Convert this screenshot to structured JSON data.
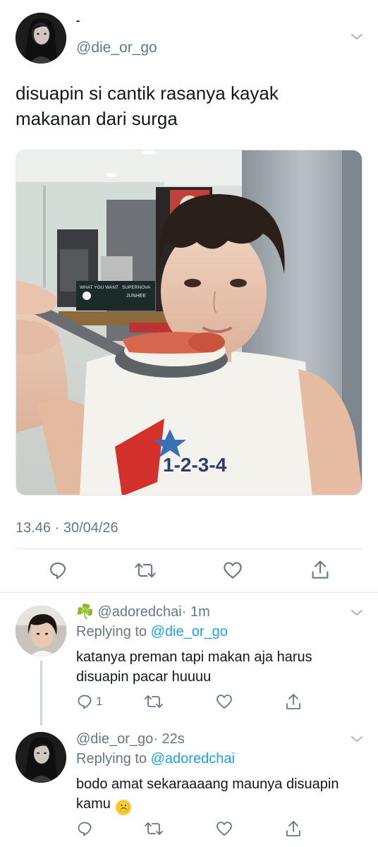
{
  "main_tweet": {
    "display_name": "-",
    "handle": "@die_or_go",
    "text_line1": "disuapin si cantik rasanya kayak",
    "text_line2": "makanan dari surga",
    "photo_sign_1": "WHAT YOU WANT",
    "photo_sign_2": "SUPERNOVA",
    "photo_sign_3": "JUNHEE",
    "photo_shirt_text": "1-2-3-4",
    "timestamp": "13.46 · 30/04/26",
    "actions": [
      "reply-icon",
      "retweet-icon",
      "like-icon",
      "share-icon"
    ]
  },
  "replies": [
    {
      "emoji": "☘️",
      "handle": "@adoredchai",
      "time": "· 1m",
      "replying_prefix": "Replying to",
      "replying_to": "@die_or_go",
      "text_line1": "katanya preman tapi makan aja harus",
      "text_line2": "disuapin pacar huuuu",
      "reply_count": "1"
    },
    {
      "handle": "@die_or_go",
      "time": "· 22s",
      "replying_prefix": "Replying to",
      "replying_to": "@adoredchai",
      "text_line1": "bodo amat sekaraaaang maunya disuapin",
      "text_line2": "kamu",
      "emoji": "☹️"
    }
  ],
  "colors": {
    "link": "#1da1f2",
    "muted": "#657786",
    "divider": "#e1e8ed"
  }
}
